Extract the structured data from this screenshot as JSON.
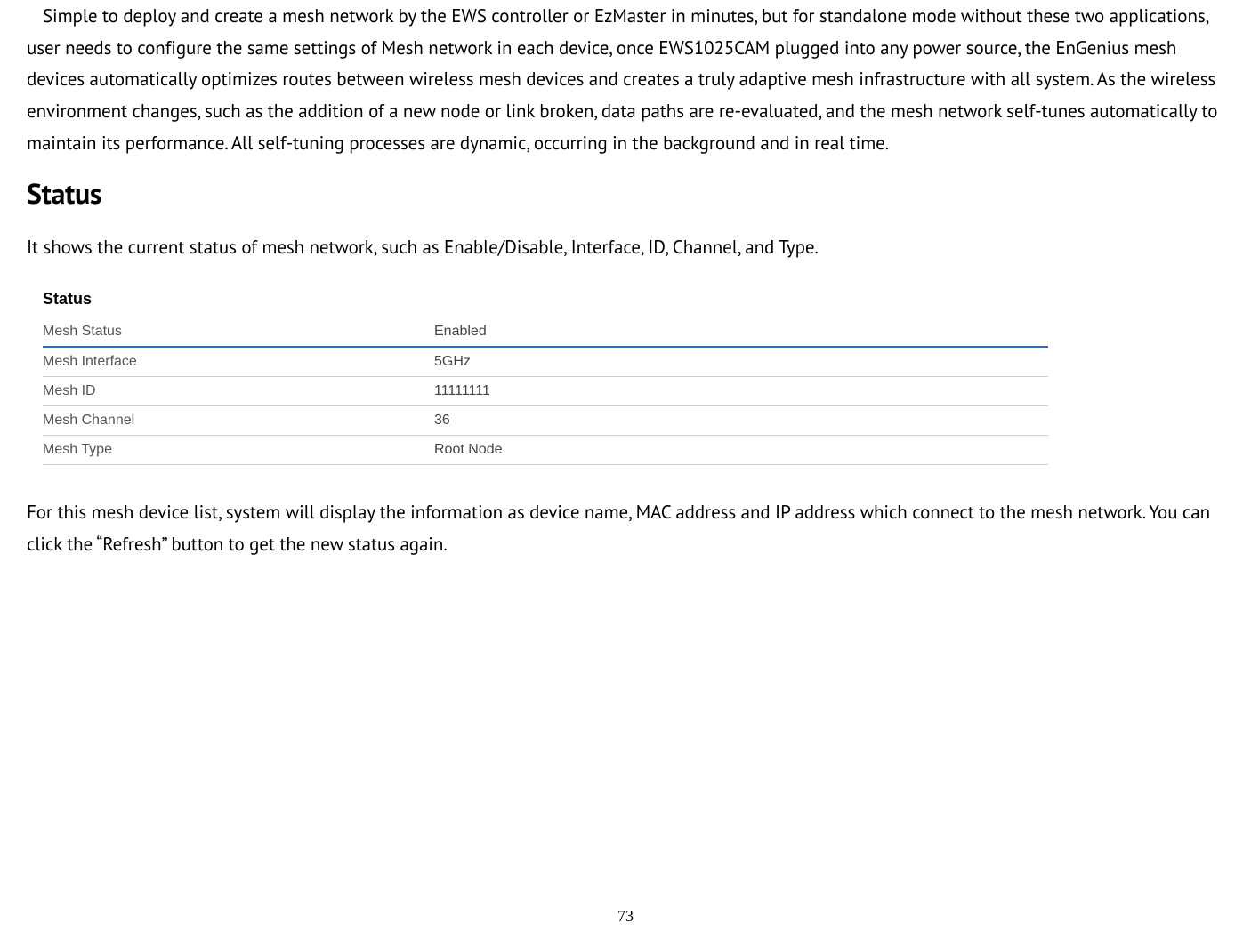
{
  "intro_paragraph": "Simple to deploy and create a mesh network by the EWS controller or EzMaster in minutes, but for standalone mode without these two applications, user needs to configure the same settings of Mesh network in each device, once EWS1025CAM plugged into any power source, the EnGenius mesh devices automatically optimizes routes between wireless mesh devices and creates a truly adaptive mesh infrastructure with all system. As the wireless environment changes, such as the addition of a new node or link broken, data paths are re-evaluated, and the mesh network self-tunes automatically to maintain its performance. All self-tuning processes are dynamic, occurring in the background and in real time.",
  "status": {
    "heading": "Status",
    "desc": "It shows the current status of mesh network, such as Enable/Disable, Interface, ID, Channel, and Type.",
    "table_title": "Status",
    "rows": [
      {
        "key": "Mesh Status",
        "value": "Enabled"
      },
      {
        "key": "Mesh Interface",
        "value": "5GHz"
      },
      {
        "key": "Mesh ID",
        "value": "11111111"
      },
      {
        "key": "Mesh Channel",
        "value": "36"
      },
      {
        "key": "Mesh Type",
        "value": "Root Node"
      }
    ]
  },
  "device_list_paragraph": "For this mesh device list, system will display the information as device name, MAC address and IP address which connect to the mesh network. You can click the “Refresh” button to get the new status again.",
  "page_number": "73"
}
